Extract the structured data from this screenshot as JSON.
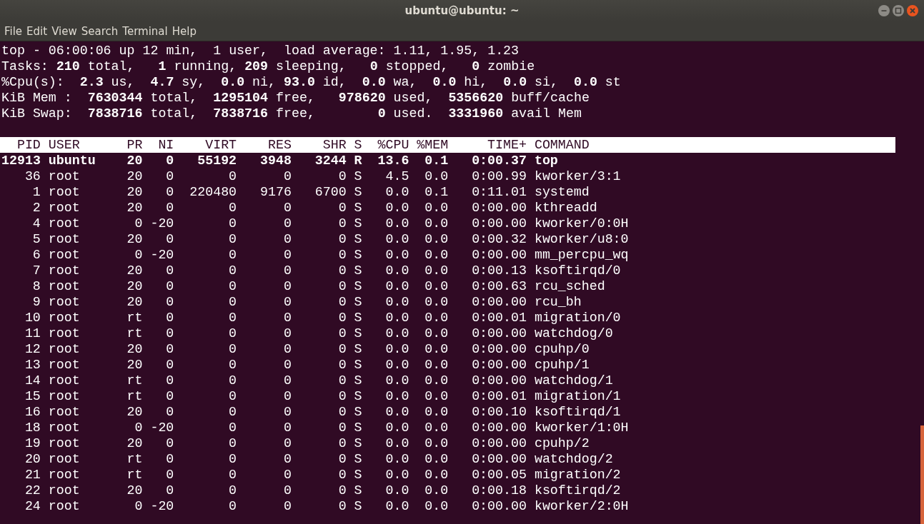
{
  "window": {
    "title": "ubuntu@ubuntu: ~"
  },
  "menu": [
    "File",
    "Edit",
    "View",
    "Search",
    "Terminal",
    "Help"
  ],
  "summary": [
    "top - 06:00:06 up 12 min,  1 user,  load average: 1.11, 1.95, 1.23",
    "Tasks: **210** total,   **1** running, **209** sleeping,   **0** stopped,   **0** zombie",
    "%Cpu(s):  **2.3** us,  **4.7** sy,  **0.0** ni, **93.0** id,  **0.0** wa,  **0.0** hi,  **0.0** si,  **0.0** st",
    "KiB Mem :  **7630344** total,  **1295104** free,   **978620** used,  **5356620** buff/cache",
    "KiB Swap:  **7838716** total,  **7838716** free,        **0** used.  **3331960** avail Mem"
  ],
  "columns": [
    "PID",
    "USER",
    "PR",
    "NI",
    "VIRT",
    "RES",
    "SHR",
    "S",
    "%CPU",
    "%MEM",
    "TIME+",
    "COMMAND"
  ],
  "rows": [
    {
      "bold": true,
      "cells": [
        "12913",
        "ubuntu",
        "20",
        "0",
        "55192",
        "3948",
        "3244",
        "R",
        "13.6",
        "0.1",
        "0:00.37",
        "top"
      ]
    },
    {
      "bold": false,
      "cells": [
        "36",
        "root",
        "20",
        "0",
        "0",
        "0",
        "0",
        "S",
        "4.5",
        "0.0",
        "0:00.99",
        "kworker/3:1"
      ]
    },
    {
      "bold": false,
      "cells": [
        "1",
        "root",
        "20",
        "0",
        "220480",
        "9176",
        "6700",
        "S",
        "0.0",
        "0.1",
        "0:11.01",
        "systemd"
      ]
    },
    {
      "bold": false,
      "cells": [
        "2",
        "root",
        "20",
        "0",
        "0",
        "0",
        "0",
        "S",
        "0.0",
        "0.0",
        "0:00.00",
        "kthreadd"
      ]
    },
    {
      "bold": false,
      "cells": [
        "4",
        "root",
        "0",
        "-20",
        "0",
        "0",
        "0",
        "S",
        "0.0",
        "0.0",
        "0:00.00",
        "kworker/0:0H"
      ]
    },
    {
      "bold": false,
      "cells": [
        "5",
        "root",
        "20",
        "0",
        "0",
        "0",
        "0",
        "S",
        "0.0",
        "0.0",
        "0:00.32",
        "kworker/u8:0"
      ]
    },
    {
      "bold": false,
      "cells": [
        "6",
        "root",
        "0",
        "-20",
        "0",
        "0",
        "0",
        "S",
        "0.0",
        "0.0",
        "0:00.00",
        "mm_percpu_wq"
      ]
    },
    {
      "bold": false,
      "cells": [
        "7",
        "root",
        "20",
        "0",
        "0",
        "0",
        "0",
        "S",
        "0.0",
        "0.0",
        "0:00.13",
        "ksoftirqd/0"
      ]
    },
    {
      "bold": false,
      "cells": [
        "8",
        "root",
        "20",
        "0",
        "0",
        "0",
        "0",
        "S",
        "0.0",
        "0.0",
        "0:00.63",
        "rcu_sched"
      ]
    },
    {
      "bold": false,
      "cells": [
        "9",
        "root",
        "20",
        "0",
        "0",
        "0",
        "0",
        "S",
        "0.0",
        "0.0",
        "0:00.00",
        "rcu_bh"
      ]
    },
    {
      "bold": false,
      "cells": [
        "10",
        "root",
        "rt",
        "0",
        "0",
        "0",
        "0",
        "S",
        "0.0",
        "0.0",
        "0:00.01",
        "migration/0"
      ]
    },
    {
      "bold": false,
      "cells": [
        "11",
        "root",
        "rt",
        "0",
        "0",
        "0",
        "0",
        "S",
        "0.0",
        "0.0",
        "0:00.00",
        "watchdog/0"
      ]
    },
    {
      "bold": false,
      "cells": [
        "12",
        "root",
        "20",
        "0",
        "0",
        "0",
        "0",
        "S",
        "0.0",
        "0.0",
        "0:00.00",
        "cpuhp/0"
      ]
    },
    {
      "bold": false,
      "cells": [
        "13",
        "root",
        "20",
        "0",
        "0",
        "0",
        "0",
        "S",
        "0.0",
        "0.0",
        "0:00.00",
        "cpuhp/1"
      ]
    },
    {
      "bold": false,
      "cells": [
        "14",
        "root",
        "rt",
        "0",
        "0",
        "0",
        "0",
        "S",
        "0.0",
        "0.0",
        "0:00.00",
        "watchdog/1"
      ]
    },
    {
      "bold": false,
      "cells": [
        "15",
        "root",
        "rt",
        "0",
        "0",
        "0",
        "0",
        "S",
        "0.0",
        "0.0",
        "0:00.01",
        "migration/1"
      ]
    },
    {
      "bold": false,
      "cells": [
        "16",
        "root",
        "20",
        "0",
        "0",
        "0",
        "0",
        "S",
        "0.0",
        "0.0",
        "0:00.10",
        "ksoftirqd/1"
      ]
    },
    {
      "bold": false,
      "cells": [
        "18",
        "root",
        "0",
        "-20",
        "0",
        "0",
        "0",
        "S",
        "0.0",
        "0.0",
        "0:00.00",
        "kworker/1:0H"
      ]
    },
    {
      "bold": false,
      "cells": [
        "19",
        "root",
        "20",
        "0",
        "0",
        "0",
        "0",
        "S",
        "0.0",
        "0.0",
        "0:00.00",
        "cpuhp/2"
      ]
    },
    {
      "bold": false,
      "cells": [
        "20",
        "root",
        "rt",
        "0",
        "0",
        "0",
        "0",
        "S",
        "0.0",
        "0.0",
        "0:00.00",
        "watchdog/2"
      ]
    },
    {
      "bold": false,
      "cells": [
        "21",
        "root",
        "rt",
        "0",
        "0",
        "0",
        "0",
        "S",
        "0.0",
        "0.0",
        "0:00.05",
        "migration/2"
      ]
    },
    {
      "bold": false,
      "cells": [
        "22",
        "root",
        "20",
        "0",
        "0",
        "0",
        "0",
        "S",
        "0.0",
        "0.0",
        "0:00.18",
        "ksoftirqd/2"
      ]
    },
    {
      "bold": false,
      "cells": [
        "24",
        "root",
        "0",
        "-20",
        "0",
        "0",
        "0",
        "S",
        "0.0",
        "0.0",
        "0:00.00",
        "kworker/2:0H"
      ]
    }
  ]
}
